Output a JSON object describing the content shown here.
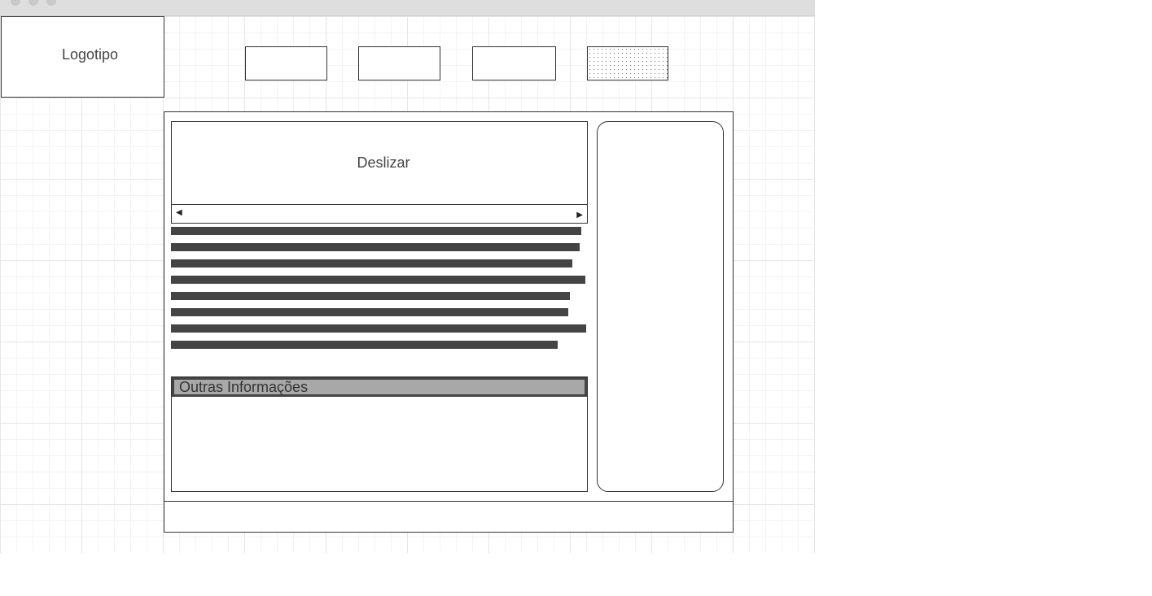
{
  "header": {
    "logo_text": "Logotipo",
    "nav_buttons": [
      {
        "label": "",
        "state": "default"
      },
      {
        "label": "",
        "state": "default"
      },
      {
        "label": "",
        "state": "default"
      },
      {
        "label": "",
        "state": "selected"
      }
    ]
  },
  "content": {
    "slider_label": "Deslizar",
    "scroll_left_icon": "◀",
    "scroll_right_icon": "▶",
    "text_placeholder_line_count": 8,
    "info_title": "Outras Informações"
  },
  "sidebar": {
    "label": ""
  },
  "footer": {
    "text": ""
  },
  "colors": {
    "line": "#333333",
    "text_block": "#444444",
    "info_header_fill": "#a8a8a8"
  }
}
